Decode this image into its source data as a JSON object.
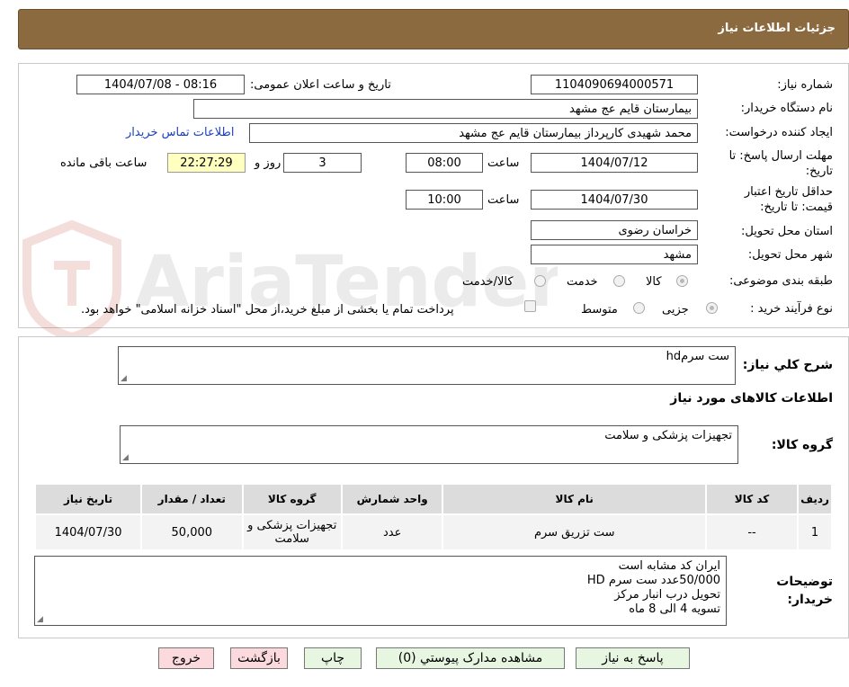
{
  "header": {
    "title": "جزئیات اطلاعات نیاز"
  },
  "watermark": {
    "text": "AriaTender.neT"
  },
  "info": {
    "need_number_label": "شماره نیاز:",
    "need_number": "1104090694000571",
    "announce_label": "تاریخ و ساعت اعلان عمومی:",
    "announce_value": "1404/07/08 - 08:16",
    "buyer_org_label": "نام دستگاه خریدار:",
    "buyer_org": "بیمارستان قایم  عج  مشهد",
    "creator_label": "ایجاد کننده درخواست:",
    "creator": "محمد شهیدی کارپرداز بیمارستان قایم  عج  مشهد",
    "contact_link": "اطلاعات تماس خریدار",
    "deadline_label": "مهلت ارسال پاسخ: تا تاریخ:",
    "deadline_date": "1404/07/12",
    "time_label": "ساعت",
    "deadline_time": "08:00",
    "days": "3",
    "days_label": "روز و",
    "remaining_time": "22:27:29",
    "remaining_label": "ساعت باقی مانده",
    "validity_label": "حداقل تاریخ اعتبار قیمت: تا تاریخ:",
    "validity_date": "1404/07/30",
    "validity_time": "10:00",
    "province_label": "استان محل تحویل:",
    "province": "خراسان رضوی",
    "city_label": "شهر محل تحویل:",
    "city": "مشهد",
    "category_label": "طبقه بندی موضوعی:",
    "category_options": [
      "کالا",
      "خدمت",
      "کالا/خدمت"
    ],
    "process_label": "نوع فرآیند خرید :",
    "process_options": [
      "جزیی",
      "متوسط"
    ],
    "payment_note": "پرداخت تمام یا بخشی از مبلغ خرید،از محل \"اسناد خزانه اسلامی\" خواهد بود."
  },
  "details": {
    "general_desc_label": "شرح کلي نیاز:",
    "general_desc": "ست سرمhd",
    "goods_info_title": "اطلاعات کالاهای مورد نیاز",
    "goods_group_label": "گروه کالا:",
    "goods_group": "تجهیزات پزشکی و سلامت",
    "table": {
      "headers": [
        "ردیف",
        "کد کالا",
        "نام کالا",
        "واحد شمارش",
        "گروه کالا",
        "تعداد / مقدار",
        "تاریخ نیاز"
      ],
      "rows": [
        [
          "1",
          "--",
          "ست تزریق سرم",
          "عدد",
          "تجهیزات پزشکی و سلامت",
          "50,000",
          "1404/07/30"
        ]
      ]
    },
    "buyer_notes_label": "توضیحات خریدار:",
    "buyer_notes": [
      "ایران کد مشابه  است",
      "50/000عدد ست سرم HD",
      "تحویل درب انبار مرکز",
      "تسویه 4 الی 8 ماه"
    ]
  },
  "buttons": {
    "reply": "پاسخ به نیاز",
    "attachments": "مشاهده مدارک پیوستي (0)",
    "print": "چاپ",
    "back": "بازگشت",
    "exit": "خروج"
  }
}
